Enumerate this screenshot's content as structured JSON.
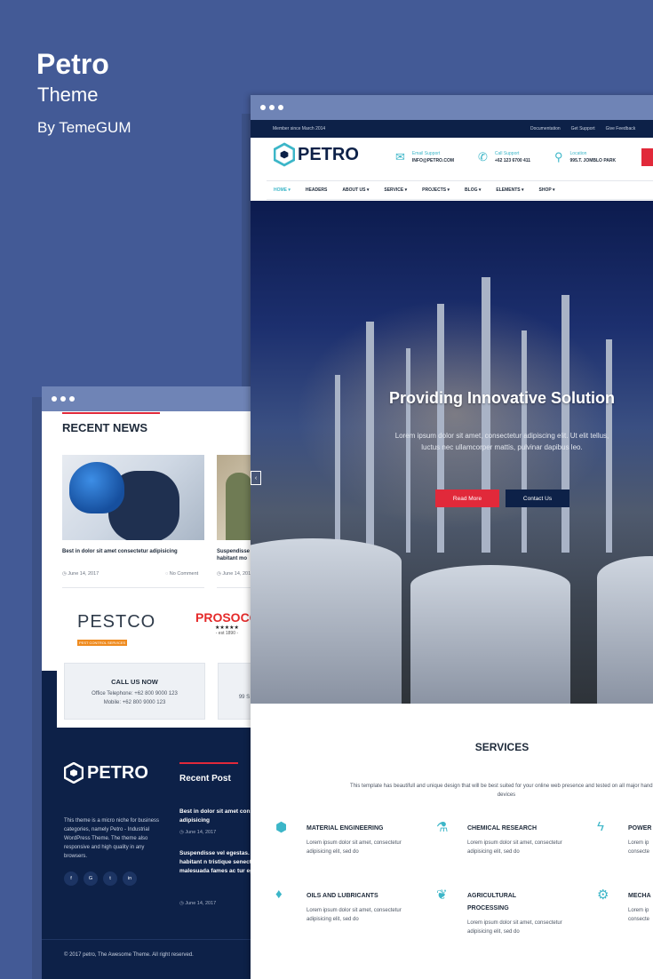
{
  "promo": {
    "title": "Petro",
    "subtitle": "Theme",
    "author": "By TemeGUM"
  },
  "back": {
    "recent_news": "RECENT NEWS",
    "news": [
      {
        "caption": "Best in dolor sit amet consectetur adipisicing",
        "date": "June 14, 2017",
        "comments": "No Comment"
      },
      {
        "caption": "Suspendisse habitant mo",
        "date": "June 14, 2017"
      }
    ],
    "logos": {
      "pestco": "PESTCO",
      "pestco_tag": "PEST CONTROL SERVICES",
      "prosocc": "PROSOCC",
      "prosocc_stars": "★★★★★",
      "prosocc_est": "- est 1890 -"
    },
    "call": {
      "title": "CALL US NOW",
      "phone": "Office Telephone: +62 800 9000 123",
      "mobile": "Mobile: +62 800 9000 123",
      "partial": "99 S"
    },
    "footer": {
      "logo": "PETRO",
      "desc": "This theme is a micro niche for business categories, namely Petro - Industrial WordPress Theme. The theme also responsive and high quality in any browsers.",
      "social": [
        "f",
        "G",
        "t",
        "in"
      ],
      "recent_title": "Recent Post",
      "posts": [
        {
          "title": "Best in dolor sit amet consectetur adipisicing",
          "date": "June 14, 2017"
        },
        {
          "title": "Suspendisse vel egestas. Pellentesque habitant n tristique senectus et ne malesuada fames ac tur egestas",
          "date": "June 14, 2017"
        }
      ],
      "copyright": "© 2017 petro, The Awesome Theme. All right reserved."
    }
  },
  "front": {
    "topbar": {
      "left": "Member since March 2014",
      "links": [
        "Documentation",
        "Get Support",
        "Give Feedback"
      ]
    },
    "brand": "PETRO",
    "info": [
      {
        "label": "Email Support",
        "value": "INFO@PETRO.COM",
        "icon": "✉"
      },
      {
        "label": "Call Support",
        "value": "+62 123 6700 411",
        "icon": "✆"
      },
      {
        "label": "Location",
        "value": "995.T. JOMBLO PARK",
        "icon": "⚲"
      }
    ],
    "nav": [
      "HOME",
      "HEADERS",
      "ABOUT US",
      "SERVICE",
      "PROJECTS",
      "BLOG",
      "ELEMENTS",
      "SHOP"
    ],
    "hero": {
      "title": "Providing Innovative Solution",
      "text": "Lorem ipsum dolor sit amet, consectetur adipiscing elit. Ut elit tellus, luctus nec ullamcorper mattis, pulvinar dapibus leo.",
      "read_more": "Read More",
      "contact": "Contact Us"
    },
    "services": {
      "title": "SERVICES",
      "desc": "This template has beautifull and unique design that will be best suited for your online web presence and tested on all major handheld devices",
      "items": [
        {
          "name": "MATERIAL ENGINEERING",
          "text": "Lorem ipsum dolor sit amet, consectetur adipisicing elit, sed do",
          "icon": "⬢"
        },
        {
          "name": "CHEMICAL RESEARCH",
          "text": "Lorem ipsum dolor sit amet, consectetur adipisicing elit, sed do",
          "icon": "⚗"
        },
        {
          "name": "POWER",
          "text": "Lorem ip consecte",
          "icon": "ϟ"
        },
        {
          "name": "OILS AND LUBRICANTS",
          "text": "Lorem ipsum dolor sit amet, consectetur adipisicing elit, sed do",
          "icon": "♦"
        },
        {
          "name": "AGRICULTURAL PROCESSING",
          "text": "Lorem ipsum dolor sit amet, consectetur adipisicing elit, sed do",
          "icon": "❦"
        },
        {
          "name": "MECHA",
          "text": "Lorem ip consecte",
          "icon": "⚙"
        }
      ]
    }
  }
}
